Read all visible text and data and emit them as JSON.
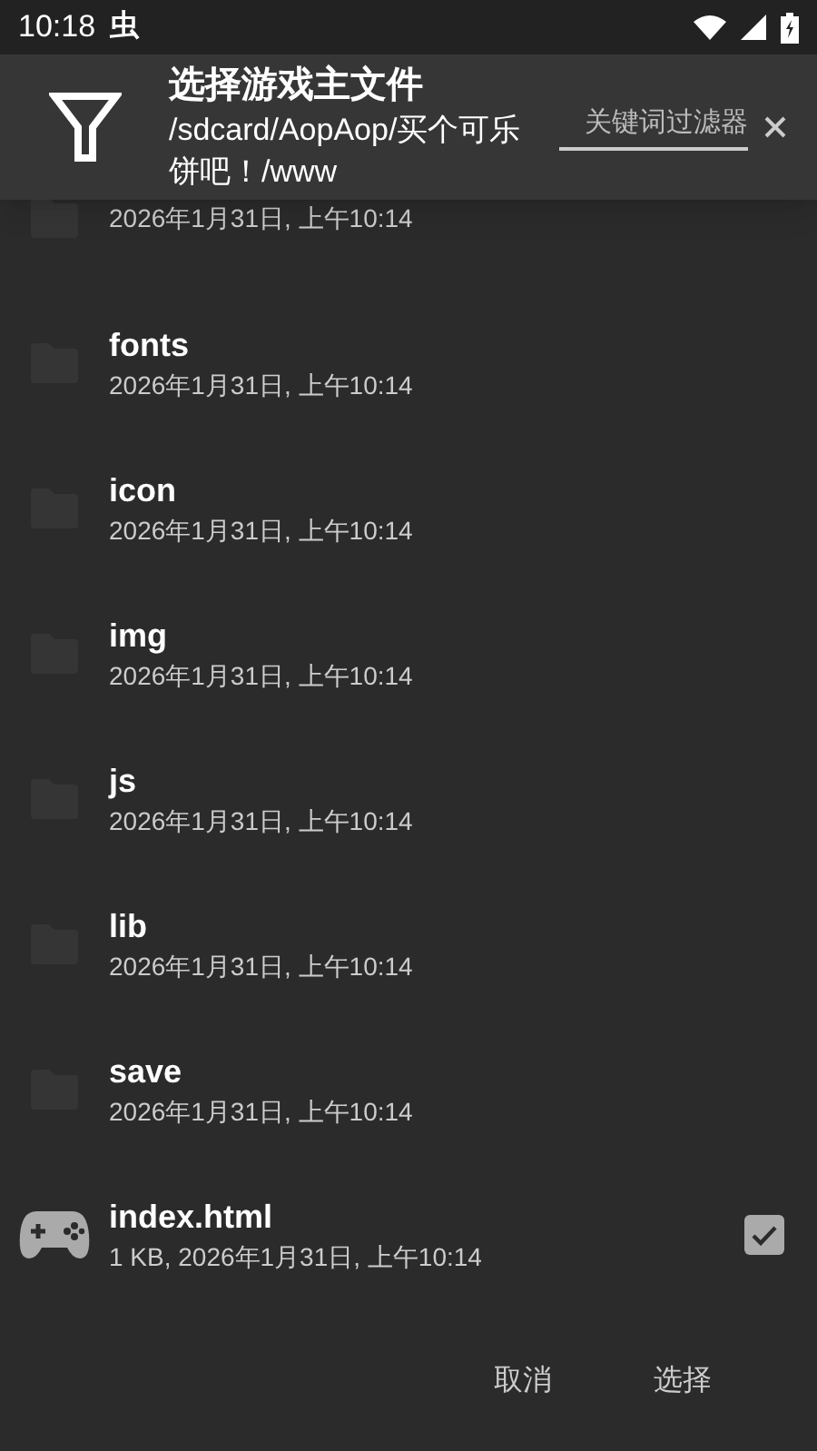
{
  "status_bar": {
    "time": "10:18",
    "notification_glyph": "虫"
  },
  "header": {
    "title": "选择游戏主文件",
    "path": "/sdcard/AopAop/买个可乐饼吧！/www",
    "filter": {
      "placeholder": "关键词过滤器"
    }
  },
  "files": [
    {
      "kind": "folder",
      "details": "2026年1月31日, 上午10:14"
    },
    {
      "kind": "folder",
      "name": "fonts",
      "details": "2026年1月31日, 上午10:14"
    },
    {
      "kind": "folder",
      "name": "icon",
      "details": "2026年1月31日, 上午10:14"
    },
    {
      "kind": "folder",
      "name": "img",
      "details": "2026年1月31日, 上午10:14"
    },
    {
      "kind": "folder",
      "name": "js",
      "details": "2026年1月31日, 上午10:14"
    },
    {
      "kind": "folder",
      "name": "lib",
      "details": "2026年1月31日, 上午10:14"
    },
    {
      "kind": "folder",
      "name": "save",
      "details": "2026年1月31日, 上午10:14"
    },
    {
      "kind": "game",
      "name": "index.html",
      "details": "1 KB, 2026年1月31日, 上午10:14",
      "checked": true
    }
  ],
  "buttons": [
    "取消",
    "选择"
  ]
}
